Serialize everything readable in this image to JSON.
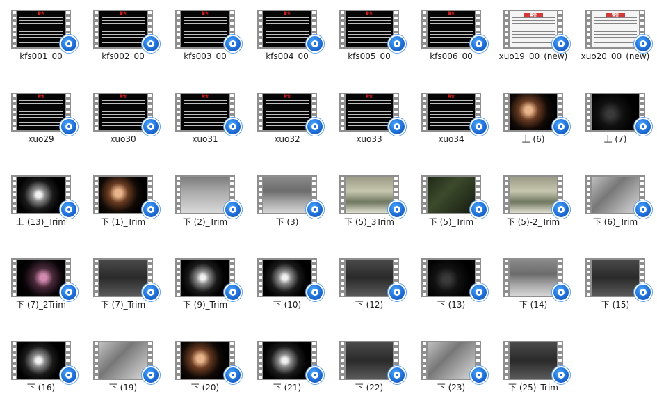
{
  "files": [
    {
      "name": "kfs001_00",
      "kind": "warn-black",
      "warn": "警告"
    },
    {
      "name": "kfs002_00",
      "kind": "warn-black",
      "warn": "警告"
    },
    {
      "name": "kfs003_00",
      "kind": "warn-black",
      "warn": "警告"
    },
    {
      "name": "kfs004_00",
      "kind": "warn-black",
      "warn": "警告"
    },
    {
      "name": "kfs005_00",
      "kind": "warn-black",
      "warn": "警告"
    },
    {
      "name": "kfs006_00",
      "kind": "warn-black",
      "warn": "警告"
    },
    {
      "name": "xuo19_00_(new)",
      "kind": "warn-white",
      "warn": "警告"
    },
    {
      "name": "xuo20_00_(new)",
      "kind": "warn-white",
      "warn": "警告"
    },
    {
      "name": "xuo29",
      "kind": "warn-black",
      "warn": "警告"
    },
    {
      "name": "xuo30",
      "kind": "warn-black",
      "warn": "警告"
    },
    {
      "name": "xuo31",
      "kind": "warn-black",
      "warn": "警告"
    },
    {
      "name": "xuo32",
      "kind": "warn-black",
      "warn": "警告"
    },
    {
      "name": "xuo33",
      "kind": "warn-black",
      "warn": "警告"
    },
    {
      "name": "xuo34",
      "kind": "warn-black",
      "warn": "警告"
    },
    {
      "name": "上 (6)",
      "kind": "photo-warm"
    },
    {
      "name": "上 (7)",
      "kind": "photo-dark"
    },
    {
      "name": "上 (13)_Trim",
      "kind": "photo-glow"
    },
    {
      "name": "下 (1)_Trim",
      "kind": "photo-warm"
    },
    {
      "name": "下 (2)_Trim",
      "kind": "photo-red"
    },
    {
      "name": "下 (3)",
      "kind": "photo-room"
    },
    {
      "name": "下 (5)_3Trim",
      "kind": "photo-tile"
    },
    {
      "name": "下 (5)_Trim",
      "kind": "photo-green"
    },
    {
      "name": "下 (5)-2_Trim",
      "kind": "photo-tile"
    },
    {
      "name": "下 (6)_Trim",
      "kind": "photo-light"
    },
    {
      "name": "下 (7)_2Trim",
      "kind": "photo-pink"
    },
    {
      "name": "下 (7)_Trim",
      "kind": "photo-grey"
    },
    {
      "name": "下 (9)_Trim",
      "kind": "photo-glow"
    },
    {
      "name": "下 (10)",
      "kind": "photo-glow"
    },
    {
      "name": "下 (12)",
      "kind": "photo-grey"
    },
    {
      "name": "下 (13)",
      "kind": "photo-dark"
    },
    {
      "name": "下 (14)",
      "kind": "photo-room"
    },
    {
      "name": "下 (15)",
      "kind": "photo-grey"
    },
    {
      "name": "下 (16)",
      "kind": "photo-glow"
    },
    {
      "name": "下 (19)",
      "kind": "photo-light"
    },
    {
      "name": "下 (20)",
      "kind": "photo-warm"
    },
    {
      "name": "下 (21)",
      "kind": "photo-glow"
    },
    {
      "name": "下 (22)",
      "kind": "photo-grey"
    },
    {
      "name": "下 (23)",
      "kind": "photo-light"
    },
    {
      "name": "下 (25)_Trim",
      "kind": "photo-grey"
    }
  ]
}
